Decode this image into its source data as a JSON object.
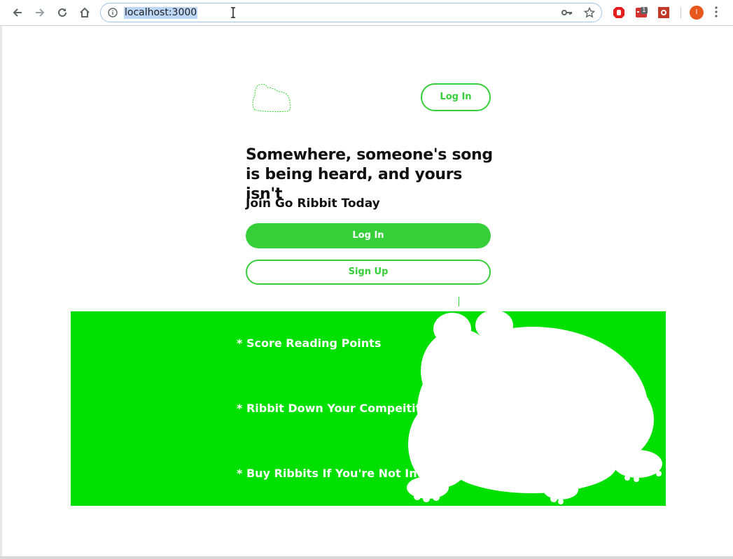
{
  "browser": {
    "url": "localhost:3000",
    "extension_badge": "1",
    "profile_initial": "I"
  },
  "header": {
    "login_label": "Log In"
  },
  "hero": {
    "headline_line1": "Somewhere, someone's song",
    "headline_line2": "is being heard, and yours isn't",
    "subhead": "Join Go Ribbit Today",
    "login_label": "Log In",
    "signup_label": "Sign Up"
  },
  "features": [
    "* Score Reading Points",
    "* Ribbit Down Your Compeititon",
    "* Buy Ribbits If You're Not Interesting"
  ],
  "colors": {
    "accent": "#36cf3a",
    "banner": "#00e000"
  }
}
